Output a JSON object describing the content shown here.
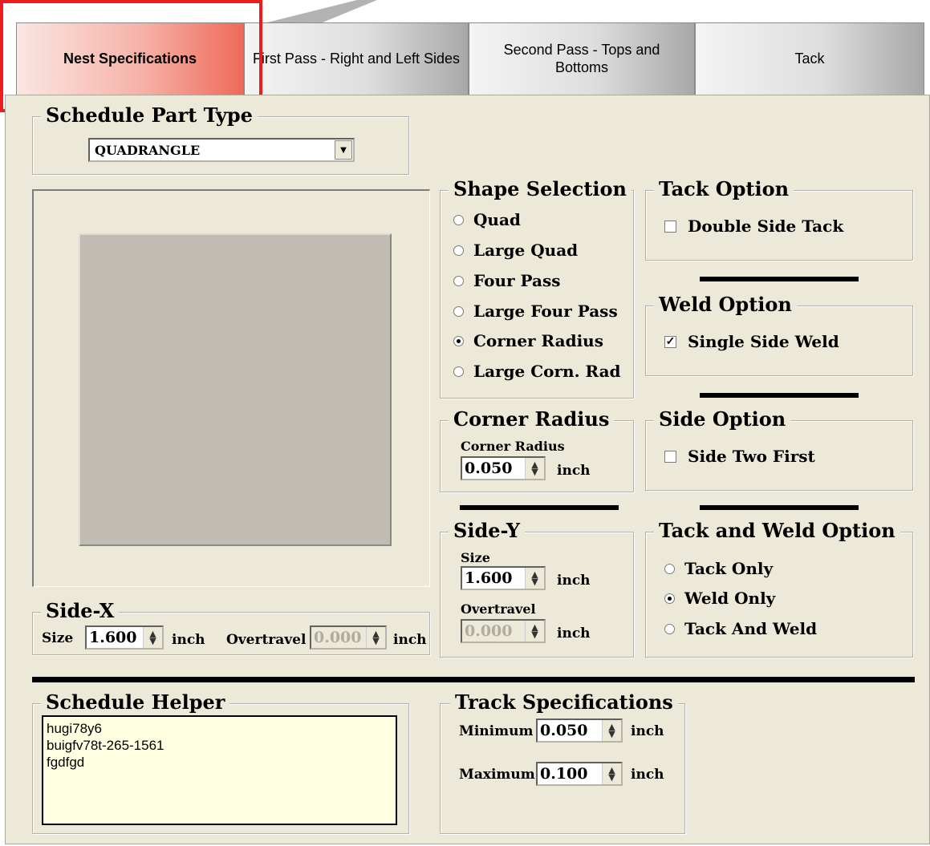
{
  "tabs": [
    {
      "label": "Nest Specifications",
      "active": true
    },
    {
      "label": "First Pass - Right and Left Sides",
      "active": false
    },
    {
      "label": "Second Pass - Tops and Bottoms",
      "active": false
    },
    {
      "label": "Tack",
      "active": false
    }
  ],
  "schedule_part_type": {
    "title": "Schedule Part Type",
    "selected": "QUADRANGLE"
  },
  "shape_selection": {
    "title": "Shape Selection",
    "options": [
      "Quad",
      "Large Quad",
      "Four Pass",
      "Large Four Pass",
      "Corner Radius",
      "Large Corn. Rad"
    ],
    "selected": "Corner Radius"
  },
  "tack_option": {
    "title": "Tack Option",
    "double_side_tack": {
      "label": "Double Side Tack",
      "checked": false
    }
  },
  "weld_option": {
    "title": "Weld Option",
    "single_side_weld": {
      "label": "Single Side Weld",
      "checked": true
    }
  },
  "side_option": {
    "title": "Side Option",
    "side_two_first": {
      "label": "Side Two First",
      "checked": false
    }
  },
  "corner_radius": {
    "title": "Corner Radius",
    "label": "Corner Radius",
    "value": "0.050",
    "unit": "inch"
  },
  "side_y": {
    "title": "Side-Y",
    "size_label": "Size",
    "size": "1.600",
    "overtravel_label": "Overtravel",
    "overtravel": "0.000",
    "unit": "inch"
  },
  "tack_weld_option": {
    "title": "Tack and Weld Option",
    "options": [
      "Tack Only",
      "Weld Only",
      "Tack And Weld"
    ],
    "selected": "Weld Only"
  },
  "side_x": {
    "title": "Side-X",
    "size_label": "Size",
    "size": "1.600",
    "overtravel_label": "Overtravel",
    "overtravel": "0.000",
    "unit": "inch"
  },
  "schedule_helper": {
    "title": "Schedule Helper",
    "lines": [
      "hugi78y6",
      "buigfv78t-265-1561",
      "fgdfgd"
    ]
  },
  "track_specifications": {
    "title": "Track Specifications",
    "minimum_label": "Minimum",
    "minimum": "0.050",
    "maximum_label": "Maximum",
    "maximum": "0.100",
    "unit": "inch"
  },
  "colors": {
    "panel": "#ece9d8",
    "callout": "#ee1c1c",
    "helper_bg": "#ffffe1",
    "active_tab": "#ef6a5a"
  }
}
